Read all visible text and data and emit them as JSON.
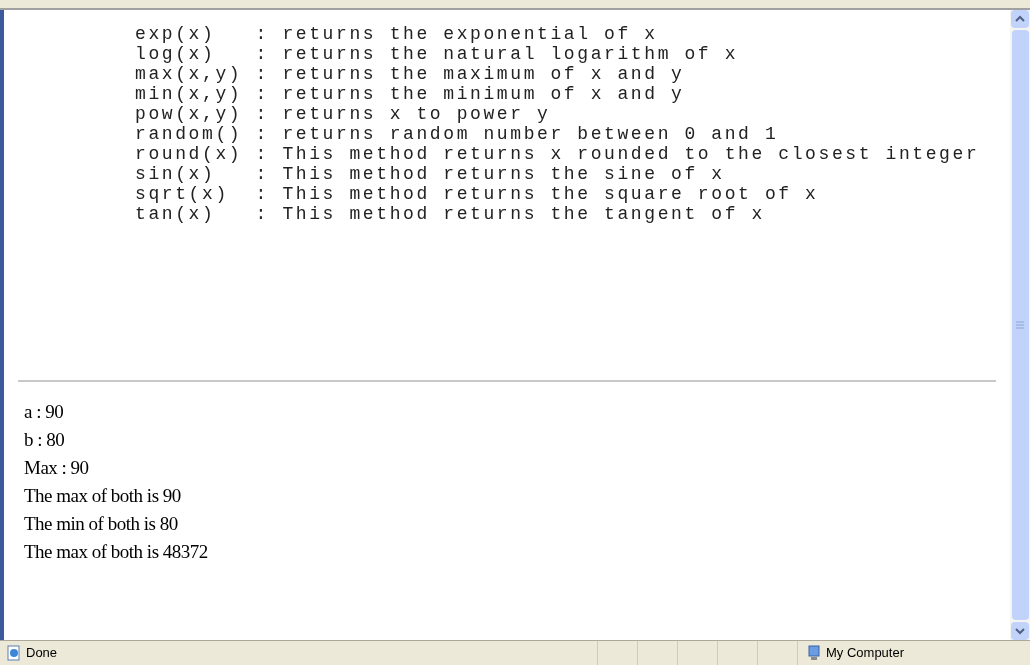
{
  "code_lines": [
    "exp(x)   : returns the exponential of x",
    "log(x)   : returns the natural logarithm of x",
    "max(x,y) : returns the maximum of x and y",
    "min(x,y) : returns the minimum of x and y",
    "pow(x,y) : returns x to power y",
    "random() : returns random number between 0 and 1",
    "round(x) : This method returns x rounded to the closest integer",
    "sin(x)   : This method returns the sine of x",
    "sqrt(x)  : This method returns the square root of x",
    "tan(x)   : This method returns the tangent of x"
  ],
  "output_lines": [
    "a : 90",
    "b : 80",
    "Max : 90",
    "The max of both is 90",
    "The min of both is 80",
    "The max of both is 48372"
  ],
  "status_bar": {
    "status": "Done",
    "zone": "My Computer"
  }
}
